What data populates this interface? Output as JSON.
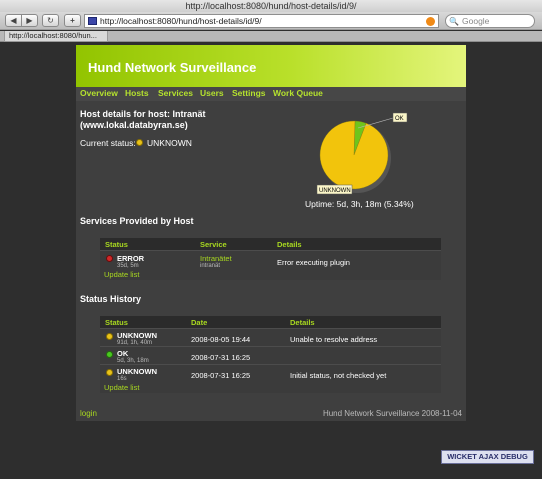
{
  "window": {
    "title": "http://localhost:8080/hund/host-details/id/9/"
  },
  "browser": {
    "url": "http://localhost:8080/hund/host-details/id/9/",
    "search_placeholder": "Google",
    "tab_label": "http://localhost:8080/hun..."
  },
  "banner": {
    "title": "Hund Network Surveillance"
  },
  "nav": {
    "items": [
      "Overview",
      "Hosts",
      "Services",
      "Users",
      "Settings",
      "Work Queue"
    ]
  },
  "host": {
    "heading_line1": "Host details for host: Intranät",
    "heading_line2": "(www.lokal.databyran.se)",
    "current_status_label": "Current status:",
    "current_status_value": "UNKNOWN"
  },
  "uptime_chart": {
    "slices": [
      {
        "label": "OK",
        "percent": 5.34,
        "color": "#6ec51c"
      },
      {
        "label": "UNKNOWN",
        "percent": 94.66,
        "color": "#f2c40c"
      }
    ],
    "caption": "Uptime: 5d, 3h, 18m (5.34%)"
  },
  "services": {
    "heading": "Services Provided by Host",
    "columns": [
      "Status",
      "Service",
      "Details"
    ],
    "rows": [
      {
        "status": "ERROR",
        "duration": "35d, 5m",
        "service": "Intranätet",
        "service_host": "intranät",
        "details": "Error executing plugin"
      }
    ],
    "update_link": "Update list"
  },
  "history": {
    "heading": "Status History",
    "columns": [
      "Status",
      "Date",
      "Details"
    ],
    "rows": [
      {
        "status": "UNKNOWN",
        "duration": "91d, 1h, 40m",
        "date": "2008-08-05 19:44",
        "details": "Unable to resolve address"
      },
      {
        "status": "OK",
        "duration": "5d, 3h, 18m",
        "date": "2008-07-31 16:25",
        "details": ""
      },
      {
        "status": "UNKNOWN",
        "duration": "16s",
        "date": "2008-07-31 16:25",
        "details": "Initial status, not checked yet"
      }
    ],
    "update_link": "Update list"
  },
  "footer": {
    "login": "login",
    "copyright": "Hund Network Surveillance 2008-11-04"
  },
  "debug_button": "WICKET AJAX DEBUG",
  "colors": {
    "accent": "#a8d820",
    "banner": "#a8d820",
    "unknown": "#f2c40c",
    "ok": "#49c820",
    "error": "#d22828"
  }
}
